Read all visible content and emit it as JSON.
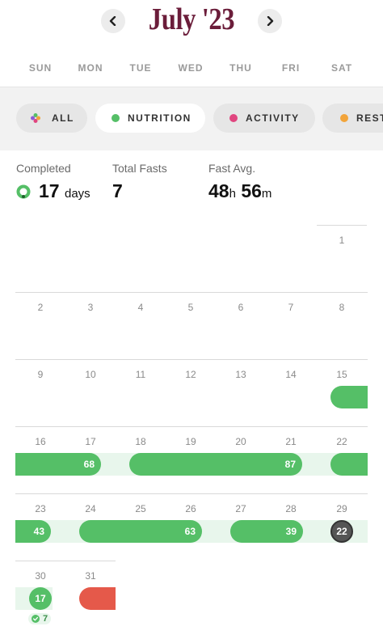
{
  "header": {
    "month_title": "July '23",
    "prev_label": "‹",
    "next_label": "›"
  },
  "weekdays": [
    "SUN",
    "MON",
    "TUE",
    "WED",
    "THU",
    "FRI",
    "SAT"
  ],
  "filters": [
    {
      "label": "ALL",
      "color": "",
      "active": false
    },
    {
      "label": "NUTRITION",
      "color": "#55bf67",
      "active": true
    },
    {
      "label": "ACTIVITY",
      "color": "#e0457f",
      "active": false
    },
    {
      "label": "REST",
      "color": "#f2a43a",
      "active": false
    }
  ],
  "stats": {
    "completed_label": "Completed",
    "completed_value": "17",
    "completed_unit": "days",
    "total_label": "Total Fasts",
    "total_value": "7",
    "avg_label": "Fast Avg.",
    "avg_hours": "48",
    "avg_h_unit": "h",
    "avg_minutes": "56",
    "avg_m_unit": "m"
  },
  "calendar": {
    "days": [
      "1",
      "2",
      "3",
      "4",
      "5",
      "6",
      "7",
      "8",
      "9",
      "10",
      "11",
      "12",
      "13",
      "14",
      "15",
      "16",
      "17",
      "18",
      "19",
      "20",
      "21",
      "22",
      "23",
      "24",
      "25",
      "26",
      "27",
      "28",
      "29",
      "30",
      "31"
    ],
    "fast_labels": {
      "f68": "68",
      "f87": "87",
      "f43": "43",
      "f63": "63",
      "f39": "39",
      "f22": "22",
      "f17": "17",
      "badge7": "7"
    }
  },
  "colors": {
    "accent_title": "#6b1d3a",
    "fast_green": "#55bf67",
    "fast_red": "#e5594a",
    "band_green": "#e8f6ec"
  }
}
